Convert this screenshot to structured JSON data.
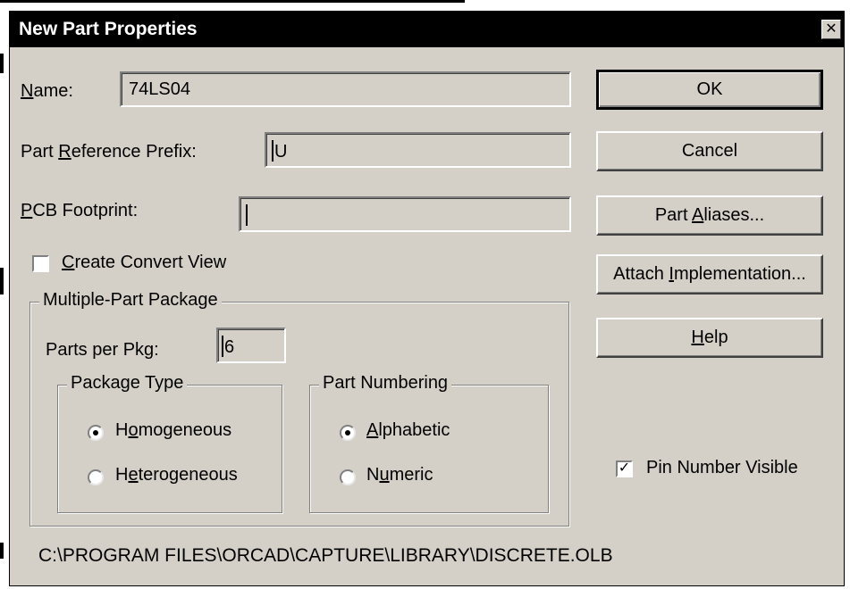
{
  "window": {
    "title": "New Part Properties",
    "close_symbol": "✕"
  },
  "fields": {
    "name": {
      "label_pre": "",
      "label_hot": "N",
      "label_post": "ame:",
      "value": "74LS04"
    },
    "prefix": {
      "label_pre": "Part ",
      "label_hot": "R",
      "label_post": "eference Prefix:",
      "value": "U"
    },
    "footprint": {
      "label_pre": "",
      "label_hot": "P",
      "label_post": "CB Footprint:",
      "value": ""
    }
  },
  "convert_view": {
    "label_pre": "",
    "label_hot": "C",
    "label_post": "reate Convert View",
    "checked": false
  },
  "multi_part": {
    "title": "Multiple-Part Package",
    "parts_per_pkg_label": "Parts per Pkg:",
    "parts_per_pkg_value": "6",
    "package_type": {
      "title": "Package Type",
      "homogeneous": {
        "label_pre": "H",
        "label_hot": "o",
        "label_post": "mogeneous",
        "selected": true
      },
      "heterogeneous": {
        "label_pre": "H",
        "label_hot": "e",
        "label_post": "terogeneous",
        "selected": false
      }
    },
    "part_numbering": {
      "title": "Part Numbering",
      "alphabetic": {
        "label_pre": "",
        "label_hot": "A",
        "label_post": "lphabetic",
        "selected": true
      },
      "numeric": {
        "label_pre": "N",
        "label_hot": "u",
        "label_post": "meric",
        "selected": false
      }
    }
  },
  "buttons": {
    "ok": "OK",
    "cancel": "Cancel",
    "aliases": {
      "pre": "Part ",
      "hot": "A",
      "post": "liases..."
    },
    "attach": {
      "pre": "Attach ",
      "hot": "I",
      "post": "mplementation..."
    },
    "help": {
      "pre": "",
      "hot": "H",
      "post": "elp"
    }
  },
  "pin_number_visible": {
    "label": "Pin Number Visible",
    "checked": true,
    "check_symbol": "✓"
  },
  "library_path": "C:\\PROGRAM FILES\\ORCAD\\CAPTURE\\LIBRARY\\DISCRETE.OLB"
}
